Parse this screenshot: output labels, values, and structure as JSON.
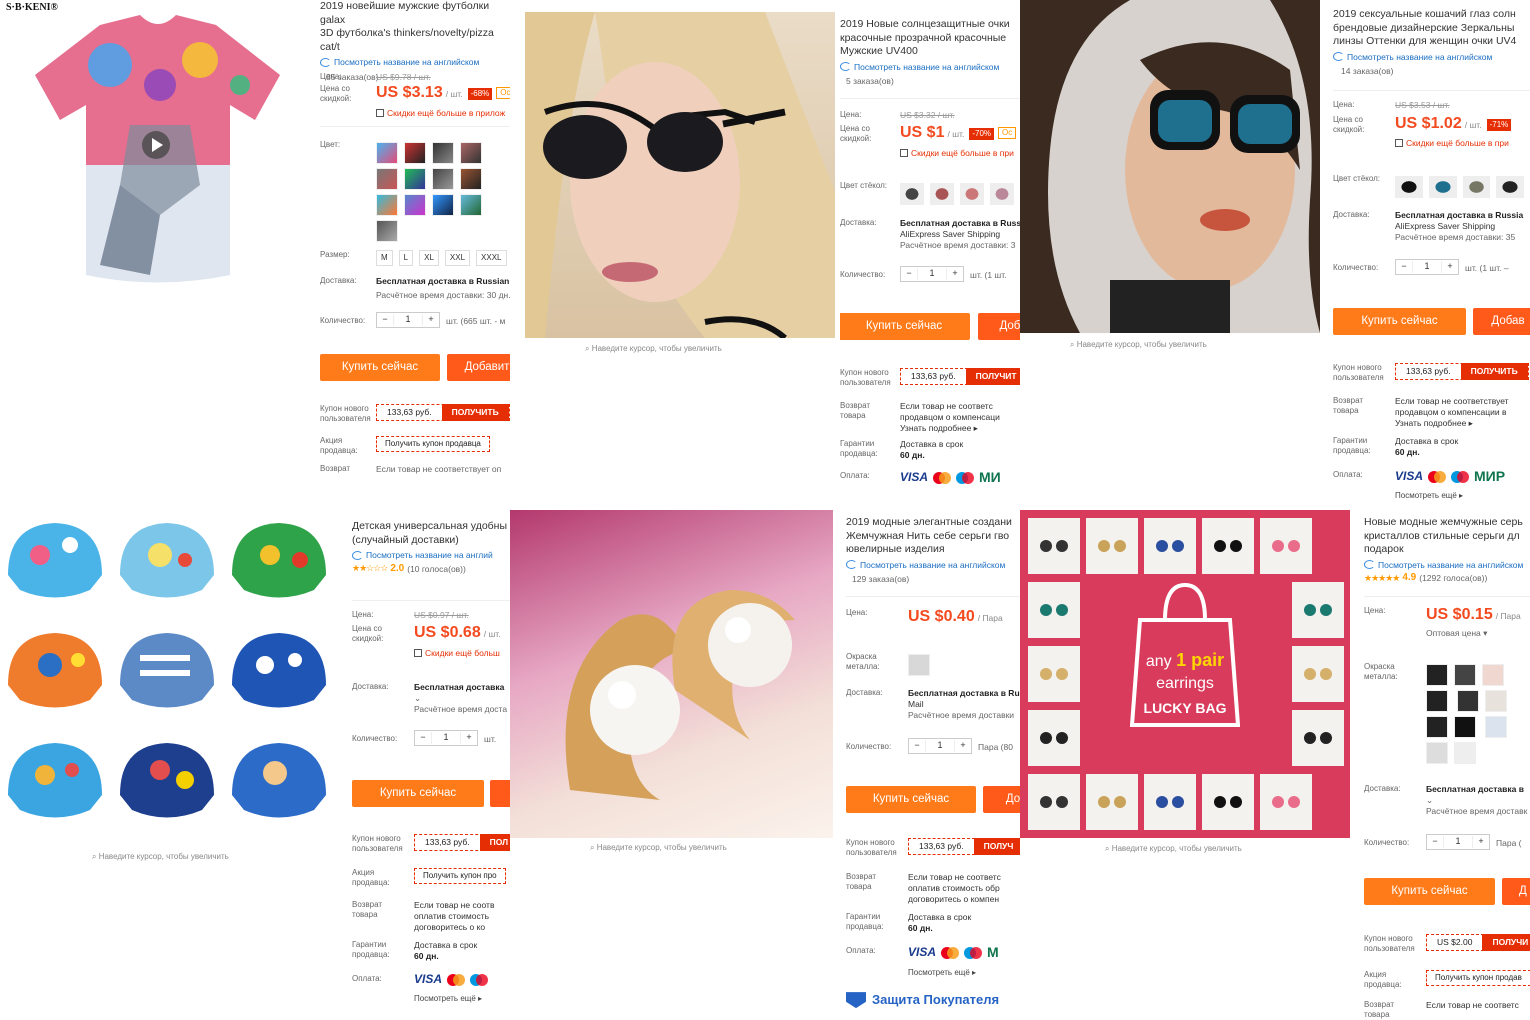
{
  "p1": {
    "brand": "S·B·KENI®",
    "title": "2019 новейшие мужские футболки galax\n3D футболка's thinkers/novelty/pizza cat/t",
    "translate": "Посмотреть название на английском",
    "orders": "85 заказа(ов)",
    "price_label": "Цена:",
    "old_price": "US $9.78 / шт.",
    "discount_label": "Цена со\nскидкой:",
    "price": "US $3.13",
    "unit": "/ шт.",
    "discount": "-68%",
    "discount2": "Ос",
    "app_note": "Скидки ещё больше в прилож",
    "color_label": "Цвет:",
    "size_label": "Размер:",
    "sizes": [
      "M",
      "L",
      "XL",
      "XXL",
      "XXXL"
    ],
    "ship_label": "Доставка:",
    "ship": "Бесплатная доставка в Russian F",
    "ship_time": "Расчётное время доставки: 30 дн.",
    "qty_label": "Количество:",
    "qty": "1",
    "qty_note": "шт. (665 шт. - м",
    "buy": "Купить сейчас",
    "add": "Добавит",
    "coupon_label": "Купон нового\nпользователя",
    "coupon_value": "133,63 руб.",
    "coupon_btn": "ПОЛУЧИТЬ",
    "seller_label": "Акция\nпродавца:",
    "seller_btn": "Получить купон продавца",
    "return_label": "Возврат",
    "return_text": "Если товар не соответствует оп"
  },
  "p2": {
    "title": "2019 Новые солнцезащитные очки\nкрасочные прозрачной красочные\nМужские UV400",
    "translate": "Посмотреть название на английском",
    "orders": "5 заказа(ов)",
    "price_label": "Цена:",
    "old_price": "US $3.32 / шт.",
    "discount_label": "Цена со\nскидкой:",
    "price": "US $1",
    "unit": "/ шт.",
    "discount": "-70%",
    "discount2": "Ос",
    "app_note": "Скидки ещё больше в при",
    "color_label": "Цвет стёкол:",
    "ship_label": "Доставка:",
    "ship": "Бесплатная доставка в Russ",
    "ship_sub": "AliExpress Saver Shipping",
    "ship_time": "Расчётное время доставки: 3",
    "qty_label": "Количество:",
    "qty": "1",
    "qty_note": "шт. (1 шт.",
    "buy": "Купить сейчас",
    "add": "Доба",
    "coupon_label": "Купон нового\nпользователя",
    "coupon_value": "133,63 руб.",
    "coupon_btn": "ПОЛУЧИТ",
    "return_label": "Возврат\nтовара",
    "return_text": "Если товар не соответс\nпродавцом о компенсаци\nУзнать подробнее ▸",
    "guarantee_label": "Гарантии\nпродавца:",
    "guarantee_text": "Доставка в срок",
    "guarantee_days": "60 дн.",
    "pay_label": "Оплата:",
    "visa": "VISA",
    "mir": "МИ",
    "zoom": "Наведите курсор, чтобы увеличить"
  },
  "p3": {
    "title": "2019 сексуальные кошачий глаз солн\nбрендовые дизайнерские Зеркальны\nлинзы Оттенки для женщин очки UV4",
    "translate": "Посмотреть название на английском",
    "orders": "14 заказа(ов)",
    "price_label": "Цена:",
    "old_price": "US $3.53 / шт.",
    "discount_label": "Цена со\nскидкой:",
    "price": "US $1.02",
    "unit": "/ шт.",
    "discount": "-71%",
    "app_note": "Скидки ещё больше в при",
    "color_label": "Цвет стёкол:",
    "ship_label": "Доставка:",
    "ship": "Бесплатная доставка в Russia",
    "ship_sub": "AliExpress Saver Shipping",
    "ship_time": "Расчётное время доставки: 35",
    "qty_label": "Количество:",
    "qty": "1",
    "qty_note": "шт. (1 шт. –",
    "buy": "Купить сейчас",
    "add": "Добав",
    "coupon_label": "Купон нового\nпользователя",
    "coupon_value": "133,63 руб.",
    "coupon_btn": "ПОЛУЧИТЬ",
    "return_label": "Возврат\nтовара",
    "return_text": "Если товар не соответствует\nпродавцом о компенсации в\nУзнать подробнее ▸",
    "guarantee_label": "Гарантии\nпродавца:",
    "guarantee_text": "Доставка в срок",
    "guarantee_days": "60 дн.",
    "pay_label": "Оплата:",
    "visa": "VISA",
    "mir": "МИР",
    "more": "Посмотреть ещё ▸",
    "zoom": "Наведите курсор, чтобы увеличить"
  },
  "p4": {
    "title": "Детская универсальная удобны\n(случайный доставки)",
    "translate": "Посмотреть название на англий",
    "rating": "2.0",
    "votes": "(10 голоса(ов))",
    "price_label": "Цена:",
    "old_price": "US $0.97 / шт.",
    "discount_label": "Цена со\nскидкой:",
    "price": "US $0.68",
    "unit": "/ шт.",
    "app_note": "Скидки ещё больш",
    "ship_label": "Доставка:",
    "ship": "Бесплатная доставка",
    "ship_time": "Расчётное время доста",
    "qty_label": "Количество:",
    "qty": "1",
    "qty_note": "шт.",
    "buy": "Купить сейчас",
    "coupon_label": "Купон нового\nпользователя",
    "coupon_value": "133,63 руб.",
    "coupon_btn": "ПОЛ",
    "seller_label": "Акция\nпродавца:",
    "seller_btn": "Получить купон про",
    "return_label": "Возврат\nтовара",
    "return_text": "Если товар не соотв\nоплатив стоимость\nдоговоритесь о ко",
    "guarantee_label": "Гарантии\nпродавца:",
    "guarantee_text": "Доставка в срок",
    "guarantee_days": "60 дн.",
    "pay_label": "Оплата:",
    "visa": "VISA",
    "more": "Посмотреть ещё ▸",
    "zoom": "Наведите курсор, чтобы увеличить"
  },
  "p5": {
    "title": "2019 модные элегантные создани\nЖемчужная Нить себе серьги гво\nювелирные изделия",
    "translate": "Посмотреть название на английском",
    "orders": "129 заказа(ов)",
    "price_label": "Цена:",
    "price": "US $0.40",
    "unit": "/ Пара",
    "color_label": "Окраска\nметалла:",
    "ship_label": "Доставка:",
    "ship": "Бесплатная доставка в Ru",
    "ship_sub": "Mail",
    "ship_time": "Расчётное время доставки",
    "qty_label": "Количество:",
    "qty": "1",
    "qty_note": "Пара (80",
    "buy": "Купить сейчас",
    "add": "До",
    "coupon_label": "Купон нового\nпользователя",
    "coupon_value": "133,63 руб.",
    "coupon_btn": "ПОЛУЧ",
    "return_label": "Возврат\nтовара",
    "return_text": "Если товар не соответс\nоплатив стоимость обр\nдоговоритесь о компен",
    "guarantee_label": "Гарантии\nпродавца:",
    "guarantee_text": "Доставка в срок",
    "guarantee_days": "60 дн.",
    "pay_label": "Оплата:",
    "visa": "VISA",
    "mir": "М",
    "more": "Посмотреть ещё ▸",
    "protect": "Защита Покупателя",
    "zoom": "Наведите курсор, чтобы увеличить"
  },
  "p6": {
    "banner_line1a": "any",
    "banner_line1b": "1 pair",
    "banner_line2": "earrings",
    "banner_line3": "LUCKY BAG",
    "zoom": "Наведите курсор, чтобы увеличить"
  },
  "p7": {
    "title": "Новые модные жемчужные серь\nкристаллов стильные серьги дл\nподарок",
    "translate": "Посмотреть название на английском",
    "rating": "4.9",
    "votes": "(1292 голоса(ов))",
    "price_label": "Цена:",
    "price": "US $0.15",
    "unit": "/ Пара",
    "wholesale": "Оптовая цена ▾",
    "color_label": "Окраска\nметалла:",
    "ship_label": "Доставка:",
    "ship": "Бесплатная доставка в",
    "ship_time": "Расчётное время доставк",
    "qty_label": "Количество:",
    "qty": "1",
    "qty_note": "Пара (",
    "buy": "Купить сейчас",
    "add": "Д",
    "coupon_label": "Купон нового\nпользователя",
    "coupon_value": "US $2.00",
    "coupon_btn": "ПОЛУЧИ",
    "seller_label": "Акция\nпродавца:",
    "seller_btn": "Получить купон продав",
    "return_label": "Возврат\nтовара",
    "return_text": "Если товар не соответс"
  },
  "colors": {
    "accent": "#ff7b1a",
    "price": "#f34a1f",
    "coupon": "#e62e04",
    "link": "#1a6ec2"
  }
}
